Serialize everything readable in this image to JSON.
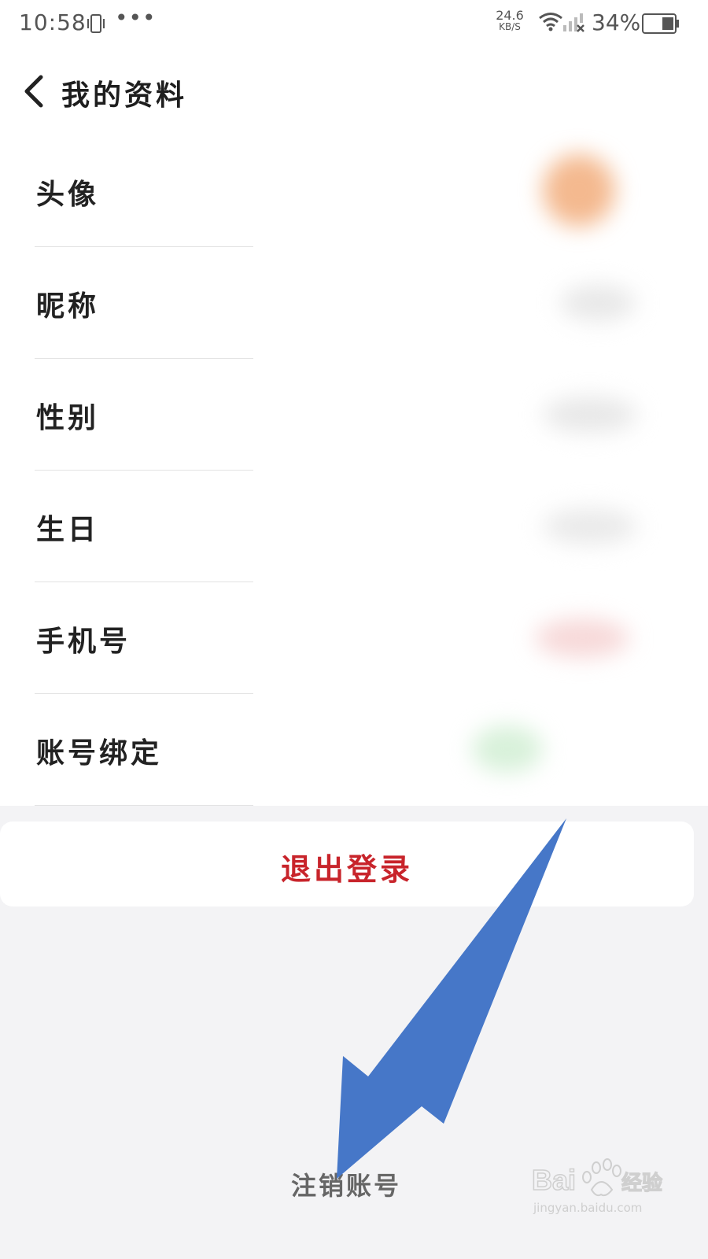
{
  "status_bar": {
    "time": "10:58",
    "dots": "•••",
    "speed_value": "24.6",
    "speed_unit": "KB/S",
    "battery_percent": "34%",
    "icons": [
      "vibrate-icon",
      "wifi-icon",
      "signal-icon",
      "battery-icon"
    ]
  },
  "header": {
    "title": "我的资料",
    "back_icon": "chevron-left-icon"
  },
  "profile_items": [
    {
      "label": "头像",
      "value_hint_color": "#f4b98f"
    },
    {
      "label": "昵称",
      "value_hint_color": "#e6e6e6"
    },
    {
      "label": "性别",
      "value_hint_color": "#e6e6e6"
    },
    {
      "label": "生日",
      "value_hint_color": "#e6e6e6"
    },
    {
      "label": "手机号",
      "value_hint_color": "#f6d6d6"
    },
    {
      "label": "账号绑定",
      "value_hint_color": "#d7f0d9"
    }
  ],
  "actions": {
    "logout_label": "退出登录",
    "cancel_account_label": "注销账号"
  },
  "colors": {
    "logout_red": "#c8242b",
    "annotation_arrow": "#4472c4"
  },
  "watermark": {
    "brand": "Bai",
    "brand_suffix": "经验",
    "url": "jingyan.baidu.com"
  }
}
